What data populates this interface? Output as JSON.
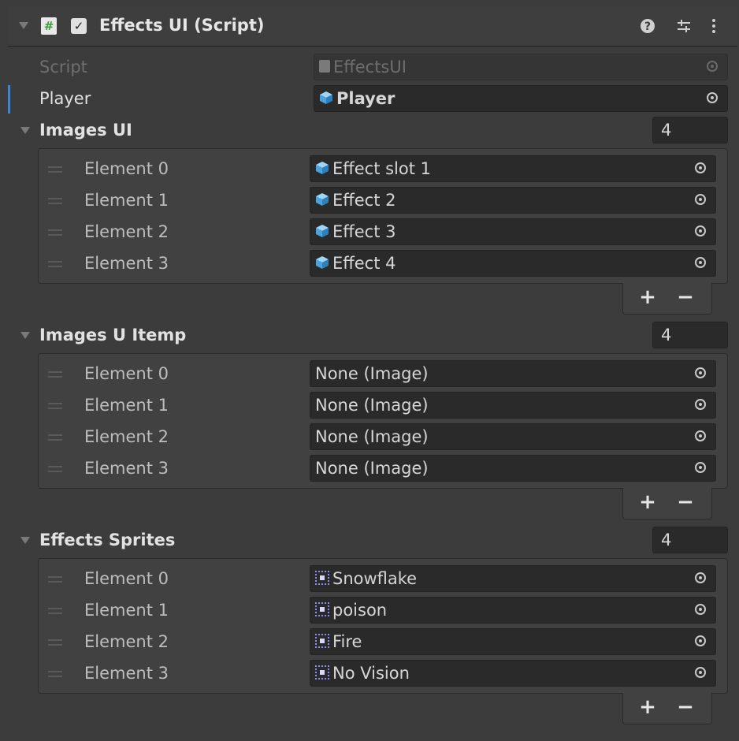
{
  "component": {
    "title": "Effects UI (Script)",
    "enabled": true,
    "icons": [
      "help-icon",
      "presets-icon",
      "more-menu-icon"
    ]
  },
  "script_field": {
    "label": "Script",
    "value": "EffectsUI"
  },
  "player_field": {
    "label": "Player",
    "value": "Player"
  },
  "images_ui": {
    "label": "Images UI",
    "count": "4",
    "items": [
      {
        "label": "Element 0",
        "value": "Effect slot 1"
      },
      {
        "label": "Element 1",
        "value": "Effect 2"
      },
      {
        "label": "Element 2",
        "value": "Effect 3"
      },
      {
        "label": "Element 3",
        "value": "Effect 4"
      }
    ]
  },
  "images_u_itemp": {
    "label": "Images U Itemp",
    "count": "4",
    "items": [
      {
        "label": "Element 0",
        "value": "None (Image)"
      },
      {
        "label": "Element 1",
        "value": "None (Image)"
      },
      {
        "label": "Element 2",
        "value": "None (Image)"
      },
      {
        "label": "Element 3",
        "value": "None (Image)"
      }
    ]
  },
  "effects_sprites": {
    "label": "Effects Sprites",
    "count": "4",
    "items": [
      {
        "label": "Element 0",
        "value": "Snowflake"
      },
      {
        "label": "Element 1",
        "value": "poison"
      },
      {
        "label": "Element 2",
        "value": "Fire"
      },
      {
        "label": "Element 3",
        "value": "No Vision"
      }
    ]
  },
  "list_controls": {
    "add": "+",
    "remove": "−"
  },
  "colors": {
    "background": "#3c3c3c",
    "field": "#2a2a2a",
    "focus": "#3d86d6",
    "cube": "#4aa3df"
  }
}
